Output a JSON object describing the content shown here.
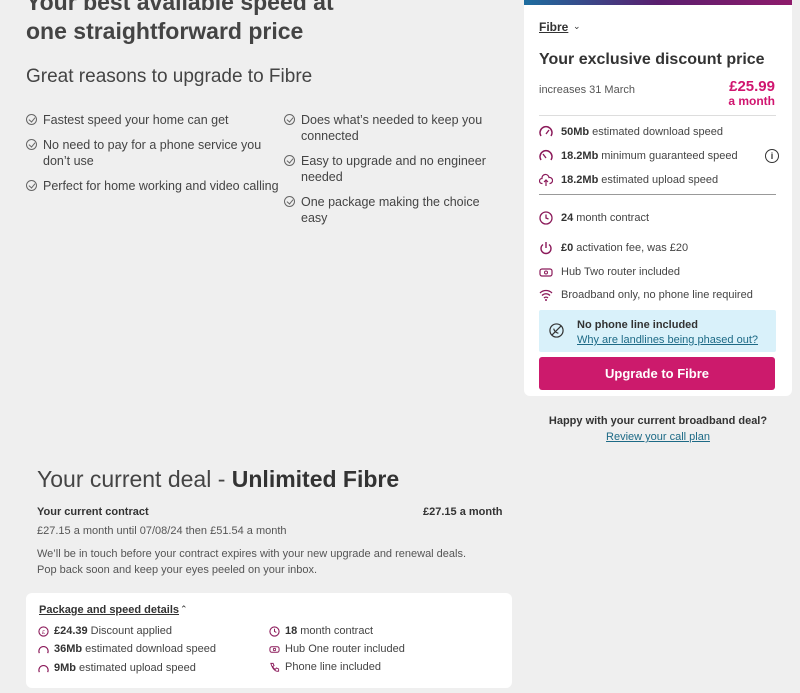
{
  "hero": {
    "title": "Your best available speed at one straightforward price",
    "subtitle": "Great reasons to upgrade to Fibre",
    "reasons_left": [
      "Fastest speed your home can get",
      "No need to pay for a phone service you don’t use",
      "Perfect for home working and video calling"
    ],
    "reasons_right": [
      "Does what’s needed to keep you connected",
      "Easy to upgrade and no engineer needed",
      "One package making the choice easy"
    ]
  },
  "offer": {
    "product_label": "Fibre",
    "title": "Your exclusive discount price",
    "increase_note": "increases 31 March",
    "price": "£25.99",
    "price_unit": "a month",
    "speeds": [
      {
        "bold": "50Mb",
        "text": "estimated download speed",
        "icon": "gauge-icon"
      },
      {
        "bold": "18.2Mb",
        "text": "minimum guaranteed speed",
        "icon": "gauge-min-icon"
      },
      {
        "bold": "18.2Mb",
        "text": "estimated upload speed",
        "icon": "cloud-upload-icon"
      }
    ],
    "extras": [
      {
        "bold": "24",
        "text": "month contract",
        "icon": "clock-icon"
      },
      {
        "bold": "£0",
        "text": "activation fee, was £20",
        "icon": "power-icon"
      },
      {
        "bold": "",
        "text": "Hub Two router included",
        "icon": "router-icon"
      },
      {
        "bold": "",
        "text": "Broadband only, no phone line required",
        "icon": "wifi-icon"
      }
    ],
    "notice_title": "No phone line included",
    "notice_link": "Why are landlines being phased out?",
    "cta": "Upgrade to Fibre",
    "accent_color": "#cc1a6c"
  },
  "side": {
    "happy_text": "Happy with your current broadband deal?",
    "review_link": "Review your call plan"
  },
  "current_deal": {
    "title_prefix": "Your current deal - ",
    "title_name": "Unlimited Fibre",
    "contract_label": "Your current contract",
    "contract_price": "£27.15 a month",
    "contract_detail": "£27.15 a month until 07/08/24 then £51.54 a month",
    "touch_line1": "We’ll be in touch before your contract expires with your new upgrade and renewal deals.",
    "touch_line2": "Pop back soon and keep your eyes peeled on your inbox.",
    "package_link": "Package and speed details",
    "package_left": [
      {
        "bold": "£24.39",
        "text": "Discount applied",
        "icon": "discount-icon"
      },
      {
        "bold": "36Mb",
        "text": "estimated download speed",
        "icon": "gauge-icon"
      },
      {
        "bold": "9Mb",
        "text": "estimated upload speed",
        "icon": "gauge-icon"
      }
    ],
    "package_right": [
      {
        "bold": "18",
        "text": "month contract",
        "icon": "clock-icon"
      },
      {
        "bold": "",
        "text": "Hub One router included",
        "icon": "router-icon"
      },
      {
        "bold": "",
        "text": "Phone line included",
        "icon": "phone-icon"
      }
    ]
  }
}
